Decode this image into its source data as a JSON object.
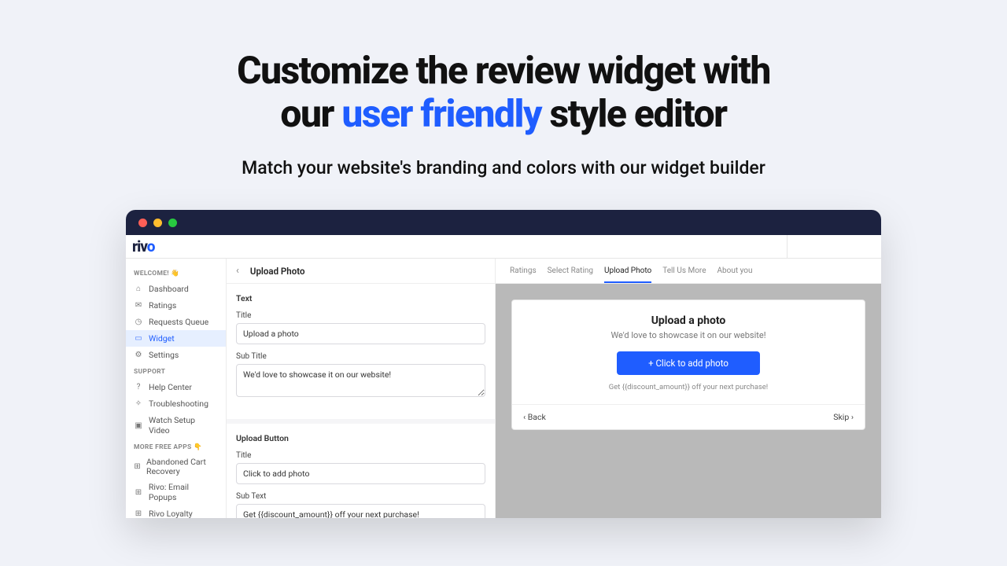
{
  "hero": {
    "line1_pre": "Customize the review widget with",
    "line2_pre": "our ",
    "line2_accent": "user friendly",
    "line2_post": " style editor",
    "sub": "Match your website's branding and colors with our widget builder"
  },
  "brand": "rivo",
  "sidebar": {
    "welcome_label": "WELCOME! 👋",
    "support_label": "SUPPORT",
    "apps_label": "MORE FREE APPS 👇",
    "items_main": [
      {
        "label": "Dashboard",
        "icon": "⌂"
      },
      {
        "label": "Ratings",
        "icon": "✉"
      },
      {
        "label": "Requests Queue",
        "icon": "◷"
      },
      {
        "label": "Widget",
        "icon": "▭",
        "active": true
      },
      {
        "label": "Settings",
        "icon": "⚙"
      }
    ],
    "items_support": [
      {
        "label": "Help Center",
        "icon": "?"
      },
      {
        "label": "Troubleshooting",
        "icon": "✧"
      },
      {
        "label": "Watch Setup Video",
        "icon": "▣"
      }
    ],
    "items_apps": [
      {
        "label": "Abandoned Cart Recovery",
        "icon": "⊞"
      },
      {
        "label": "Rivo: Email Popups",
        "icon": "⊞"
      },
      {
        "label": "Rivo Loyalty",
        "icon": "⊞"
      }
    ]
  },
  "editor": {
    "breadcrumb": "Upload Photo",
    "section_text": {
      "title": "Text",
      "field_title_label": "Title",
      "field_title_value": "Upload a photo",
      "field_sub_label": "Sub Title",
      "field_sub_value": "We'd love to showcase it on our website!"
    },
    "section_button": {
      "title": "Upload Button",
      "field_title_label": "Title",
      "field_title_value": "Click to add photo",
      "field_sub_label": "Sub Text",
      "field_sub_value": "Get {{discount_amount}} off your next purchase!"
    }
  },
  "preview": {
    "tabs": [
      "Ratings",
      "Select Rating",
      "Upload Photo",
      "Tell Us More",
      "About you"
    ],
    "active_tab": "Upload Photo",
    "card": {
      "title": "Upload a photo",
      "sub": "We'd love to showcase it on our website!",
      "button": "+ Click to add photo",
      "note": "Get {{discount_amount}} off your next purchase!",
      "back": "‹ Back",
      "skip": "Skip ›"
    }
  }
}
